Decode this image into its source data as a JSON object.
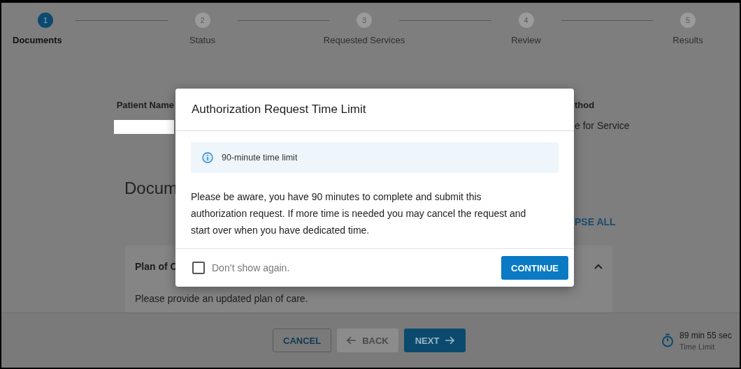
{
  "stepper": [
    {
      "number": "1",
      "label": "Documents",
      "selected": true
    },
    {
      "number": "2",
      "label": "Status",
      "selected": false
    },
    {
      "number": "3",
      "label": "Requested Services",
      "selected": false
    },
    {
      "number": "4",
      "label": "Review",
      "selected": false
    },
    {
      "number": "5",
      "label": "Results",
      "selected": false
    }
  ],
  "background": {
    "patient_label": "Patient Name",
    "method_label": "thod",
    "method_value": "e for Service",
    "section_title": "Docum",
    "collapse_link": "PSE ALL",
    "card_title": "Plan of C",
    "card_text": "Please provide an updated plan of care."
  },
  "dialog": {
    "title": "Authorization Request Time Limit",
    "notice": "90-minute time limit",
    "message": "Please be aware, you have 90 minutes to complete and submit this authorization request. If more time is needed you may cancel the request and start over when you have dedicated time.",
    "checkbox": {
      "label": "Don’t show again.",
      "checked": false
    },
    "button": "CONTINUE"
  },
  "footer": {
    "buttons": [
      {
        "label": "CANCEL",
        "kind": "outline",
        "disabled": false
      },
      {
        "label": "BACK",
        "kind": "back",
        "disabled": true
      },
      {
        "label": "NEXT",
        "kind": "next",
        "disabled": false
      }
    ],
    "timer": {
      "remaining": "89 min 55 sec",
      "label": "Time Limit"
    }
  }
}
